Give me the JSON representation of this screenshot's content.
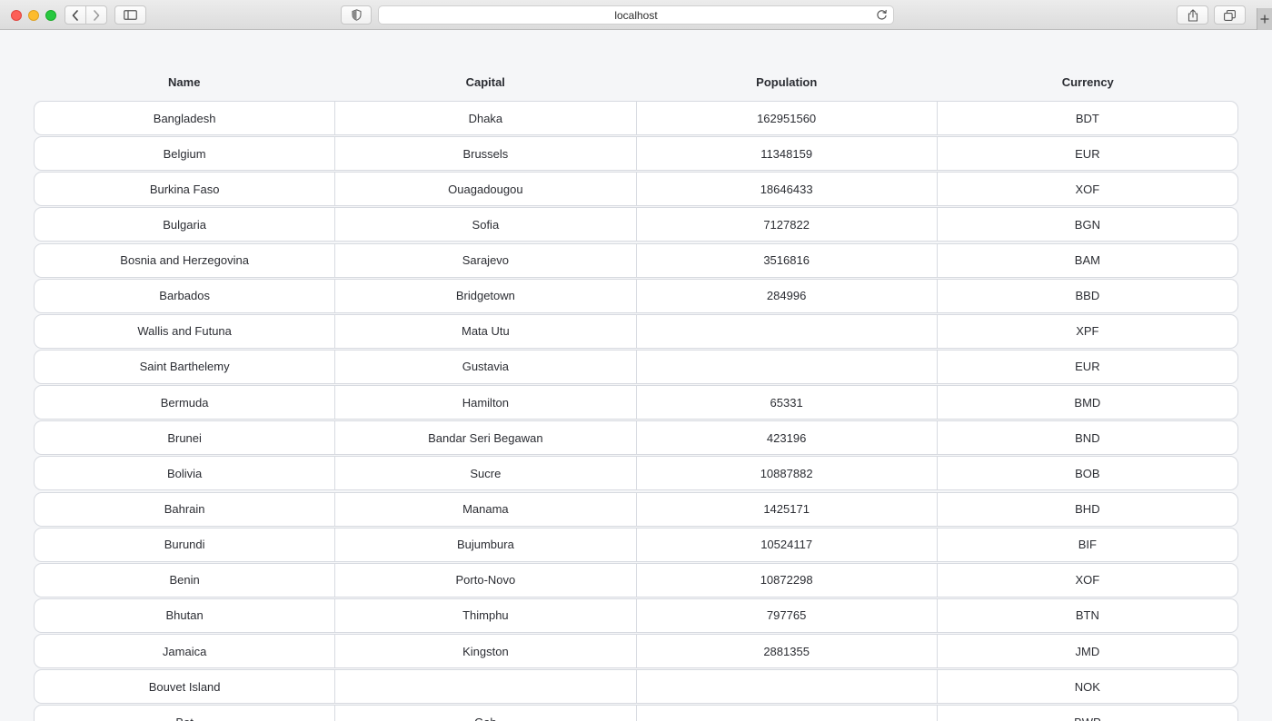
{
  "browser": {
    "address": "localhost"
  },
  "table": {
    "headers": [
      "Name",
      "Capital",
      "Population",
      "Currency"
    ],
    "rows": [
      [
        "Bangladesh",
        "Dhaka",
        "162951560",
        "BDT"
      ],
      [
        "Belgium",
        "Brussels",
        "11348159",
        "EUR"
      ],
      [
        "Burkina Faso",
        "Ouagadougou",
        "18646433",
        "XOF"
      ],
      [
        "Bulgaria",
        "Sofia",
        "7127822",
        "BGN"
      ],
      [
        "Bosnia and Herzegovina",
        "Sarajevo",
        "3516816",
        "BAM"
      ],
      [
        "Barbados",
        "Bridgetown",
        "284996",
        "BBD"
      ],
      [
        "Wallis and Futuna",
        "Mata Utu",
        "",
        "XPF"
      ],
      [
        "Saint Barthelemy",
        "Gustavia",
        "",
        "EUR"
      ],
      [
        "Bermuda",
        "Hamilton",
        "65331",
        "BMD"
      ],
      [
        "Brunei",
        "Bandar Seri Begawan",
        "423196",
        "BND"
      ],
      [
        "Bolivia",
        "Sucre",
        "10887882",
        "BOB"
      ],
      [
        "Bahrain",
        "Manama",
        "1425171",
        "BHD"
      ],
      [
        "Burundi",
        "Bujumbura",
        "10524117",
        "BIF"
      ],
      [
        "Benin",
        "Porto-Novo",
        "10872298",
        "XOF"
      ],
      [
        "Bhutan",
        "Thimphu",
        "797765",
        "BTN"
      ],
      [
        "Jamaica",
        "Kingston",
        "2881355",
        "JMD"
      ],
      [
        "Bouvet Island",
        "",
        "",
        "NOK"
      ],
      [
        "Bot",
        "Gab",
        "",
        "BWP"
      ]
    ]
  }
}
